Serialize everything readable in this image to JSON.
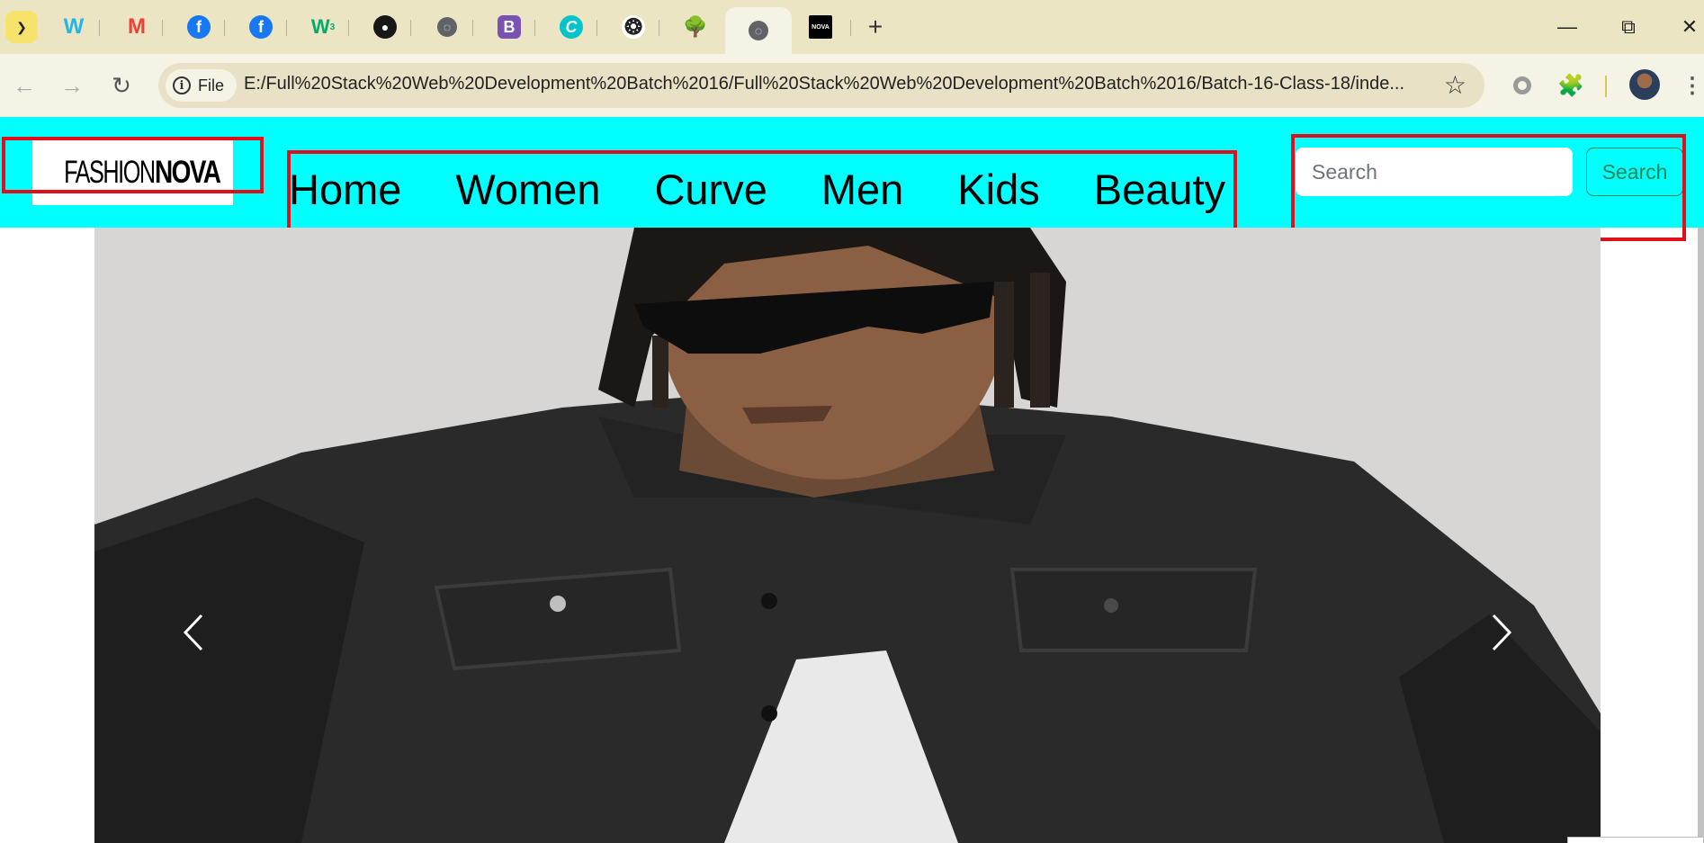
{
  "browser": {
    "tabs": [
      {
        "icon": "chevron-down-icon"
      },
      {
        "icon": "w-logo-icon",
        "color": "#22b5e6"
      },
      {
        "icon": "gmail-icon",
        "color": "#ea4335"
      },
      {
        "icon": "facebook-icon",
        "color": "#1877f2"
      },
      {
        "icon": "facebook-icon",
        "color": "#1877f2"
      },
      {
        "icon": "w3schools-icon",
        "color": "#04aa6d"
      },
      {
        "icon": "github-icon",
        "color": "#181717"
      },
      {
        "icon": "globe-icon",
        "color": "#5f6368"
      },
      {
        "icon": "bootstrap-icon",
        "color": "#7952b3"
      },
      {
        "icon": "canva-icon",
        "color": "#00c4cc"
      },
      {
        "icon": "chatgpt-icon",
        "color": "#222222"
      },
      {
        "icon": "tree-icon",
        "color": "#3a6b35"
      },
      {
        "icon": "globe-icon",
        "color": "#5f6368",
        "active": true
      },
      {
        "icon": "fashion-nova-icon",
        "color": "#000000"
      }
    ],
    "chip_label": "File",
    "url": "E:/Full%20Stack%20Web%20Development%20Batch%2016/Full%20Stack%20Web%20Development%20Batch%2016/Batch-16-Class-18/inde...",
    "accent": "#f7e26b"
  },
  "header": {
    "background": "#00ffff",
    "logo": {
      "part1": "FASHION",
      "part2": "NOVA"
    },
    "nav_items": [
      {
        "label": "Home"
      },
      {
        "label": "Women"
      },
      {
        "label": "Curve"
      },
      {
        "label": "Men"
      },
      {
        "label": "Kids"
      },
      {
        "label": "Beauty"
      }
    ],
    "search": {
      "placeholder": "Search",
      "button_label": "Search",
      "button_color": "#198754"
    }
  },
  "annotations": {
    "color": "#e0101a"
  },
  "carousel": {
    "prev_icon": "chevron-left-icon",
    "next_icon": "chevron-right-icon"
  }
}
